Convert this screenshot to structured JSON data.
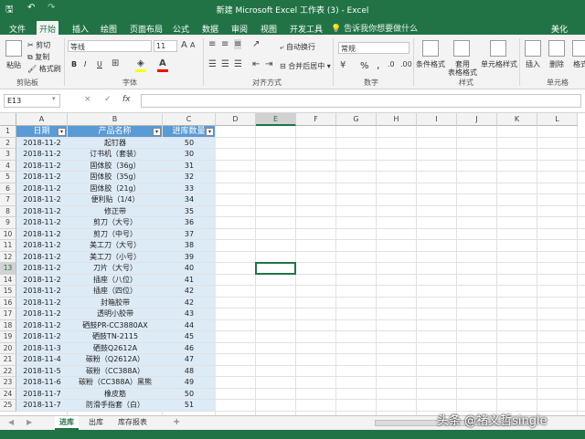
{
  "window": {
    "title": "新建 Microsoft Excel 工作表 (3)  -  Excel"
  },
  "quick_access": [
    "save-icon",
    "undo-icon",
    "redo-icon"
  ],
  "tabs": [
    "文件",
    "开始",
    "插入",
    "绘图",
    "页面布局",
    "公式",
    "数据",
    "审阅",
    "视图",
    "开发工具",
    "美化"
  ],
  "tell_me": "告诉我你想要做什么",
  "ribbon": {
    "clipboard": {
      "paste": "粘贴",
      "cut": "剪切",
      "copy": "复制",
      "format_painter": "格式刷",
      "label": "剪贴板"
    },
    "font": {
      "name": "等线",
      "size": "11",
      "bold": "B",
      "italic": "I",
      "underline": "U",
      "label": "字体",
      "fill_color": "#ffff00",
      "font_color": "#ff0000"
    },
    "alignment": {
      "wrap": "自动换行",
      "merge": "合并后居中",
      "label": "对齐方式"
    },
    "number": {
      "format": "常规",
      "percent": "%",
      "comma": ",",
      "label": "数字"
    },
    "styles": {
      "conditional": "条件格式",
      "table": "套用",
      "table2": "表格格式",
      "cell_styles": "单元格样式",
      "label": "样式"
    },
    "cells": {
      "insert": "插入",
      "delete": "删除",
      "format": "格式",
      "label": "单元格"
    }
  },
  "formula_bar": {
    "name_box": "E13",
    "cancel": "×",
    "enter": "✓",
    "fx": "fx",
    "value": ""
  },
  "grid": {
    "columns": [
      "A",
      "B",
      "C",
      "D",
      "E",
      "F",
      "G",
      "H",
      "I",
      "J",
      "K",
      "L"
    ],
    "selected_column": "E",
    "selected_row": "13",
    "rows": [
      "1",
      "2",
      "3",
      "4",
      "5",
      "6",
      "7",
      "8",
      "9",
      "10",
      "11",
      "12",
      "13",
      "14",
      "15",
      "16",
      "17",
      "18",
      "19",
      "20",
      "21",
      "22",
      "23",
      "24",
      "25"
    ],
    "table_headers": [
      "日期",
      "产品名称",
      "进库数量"
    ],
    "table_rows": [
      [
        "2018-11-2",
        "起钉器",
        "50"
      ],
      [
        "2018-11-2",
        "订书机（套装）",
        "30"
      ],
      [
        "2018-11-2",
        "固体胶（36g）",
        "31"
      ],
      [
        "2018-11-2",
        "固体胶（35g）",
        "32"
      ],
      [
        "2018-11-2",
        "固体胶（21g）",
        "33"
      ],
      [
        "2018-11-2",
        "便利贴（1/4）",
        "34"
      ],
      [
        "2018-11-2",
        "修正带",
        "35"
      ],
      [
        "2018-11-2",
        "剪刀（大号）",
        "36"
      ],
      [
        "2018-11-2",
        "剪刀（中号）",
        "37"
      ],
      [
        "2018-11-2",
        "美工刀（大号）",
        "38"
      ],
      [
        "2018-11-2",
        "美工刀（小号）",
        "39"
      ],
      [
        "2018-11-2",
        "刀片（大号）",
        "40"
      ],
      [
        "2018-11-2",
        "插座（八位）",
        "41"
      ],
      [
        "2018-11-2",
        "插座（四位）",
        "42"
      ],
      [
        "2018-11-2",
        "封箱胶带",
        "42"
      ],
      [
        "2018-11-2",
        "透明小胶带",
        "43"
      ],
      [
        "2018-11-2",
        "硒鼓PR-CC3880AX",
        "44"
      ],
      [
        "2018-11-2",
        "硒鼓TN-2115",
        "45"
      ],
      [
        "2018-11-3",
        "硒鼓Q2612A",
        "46"
      ],
      [
        "2018-11-4",
        "碳粉（Q2612A）",
        "47"
      ],
      [
        "2018-11-5",
        "碳粉（CC388A）",
        "48"
      ],
      [
        "2018-11-6",
        "碳粉（CC388A）黑熊",
        "49"
      ],
      [
        "2018-11-7",
        "橡皮筋",
        "50"
      ],
      [
        "2018-11-7",
        "防滑手指套（白）",
        "51"
      ]
    ]
  },
  "sheets": [
    "进库",
    "出库",
    "库存报表"
  ],
  "active_sheet": "进库",
  "add_sheet": "+",
  "watermark": "头条 @褚义哲single",
  "colors": {
    "excel_green": "#217346",
    "table_header": "#5b9bd5",
    "table_band": "#ddebf7"
  }
}
